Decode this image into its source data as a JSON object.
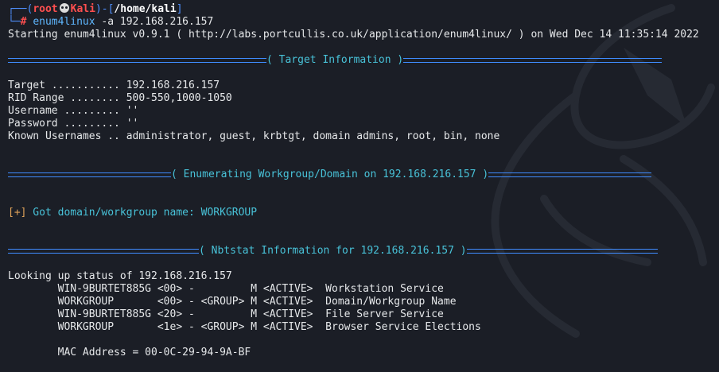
{
  "prompt": {
    "open": "┌──(",
    "user": "root",
    "host": "Kali",
    "mid": ")-[",
    "path": "/home/kali",
    "close": "]",
    "line2_prefix": "└─",
    "hash": "# ",
    "command": "enum4linux",
    "args": " -a 192.168.216.157"
  },
  "starting": "Starting enum4linux v0.9.1 ( http://labs.portcullis.co.uk/application/enum4linux/ ) on Wed Dec 14 11:35:14 2022",
  "sections": {
    "target_info": "( Target Information )",
    "enum_workgroup": "( Enumerating Workgroup/Domain on 192.168.216.157 )",
    "nbtstat": "( Nbtstat Information for 192.168.216.157 )"
  },
  "target_lines": [
    "Target ........... 192.168.216.157",
    "RID Range ........ 500-550,1000-1050",
    "Username ......... ''",
    "Password ......... ''",
    "Known Usernames .. administrator, guest, krbtgt, domain admins, root, bin, none"
  ],
  "got_domain": {
    "marker": "[+]",
    "text": " Got domain/workgroup name: WORKGROUP"
  },
  "lookup": "Looking up status of 192.168.216.157",
  "nbt_rows": [
    "        WIN-9BURTET885G <00> -         M <ACTIVE>  Workstation Service",
    "        WORKGROUP       <00> - <GROUP> M <ACTIVE>  Domain/Workgroup Name",
    "        WIN-9BURTET885G <20> -         M <ACTIVE>  File Server Service",
    "        WORKGROUP       <1e> - <GROUP> M <ACTIVE>  Browser Service Elections"
  ],
  "mac": "        MAC Address = 00-0C-29-94-9A-BF"
}
